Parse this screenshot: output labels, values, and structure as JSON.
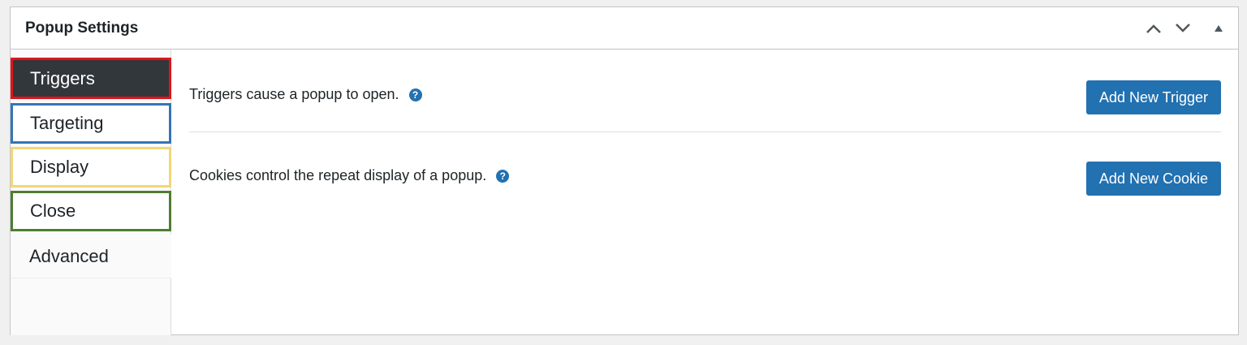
{
  "metabox": {
    "title": "Popup Settings",
    "controls": {
      "move_up_icon": "chevron-up-icon",
      "move_down_icon": "chevron-down-icon",
      "toggle_icon": "triangle-up-icon"
    }
  },
  "tabs": [
    {
      "label": "Triggers",
      "active": true,
      "outline_color": "#e0141c"
    },
    {
      "label": "Targeting",
      "active": false,
      "outline_color": "#3574b6"
    },
    {
      "label": "Display",
      "active": false,
      "outline_color": "#f3d675"
    },
    {
      "label": "Close",
      "active": false,
      "outline_color": "#4f7d32"
    },
    {
      "label": "Advanced",
      "active": false
    }
  ],
  "panel": {
    "triggers": {
      "description": "Triggers cause a popup to open.",
      "help_icon": "question-circle-icon",
      "button_label": "Add New Trigger"
    },
    "cookies": {
      "description": "Cookies control the repeat display of a popup.",
      "help_icon": "question-circle-icon",
      "button_label": "Add New Cookie"
    }
  },
  "colors": {
    "accent": "#2271b1",
    "active_tab_bg": "#32373c"
  }
}
